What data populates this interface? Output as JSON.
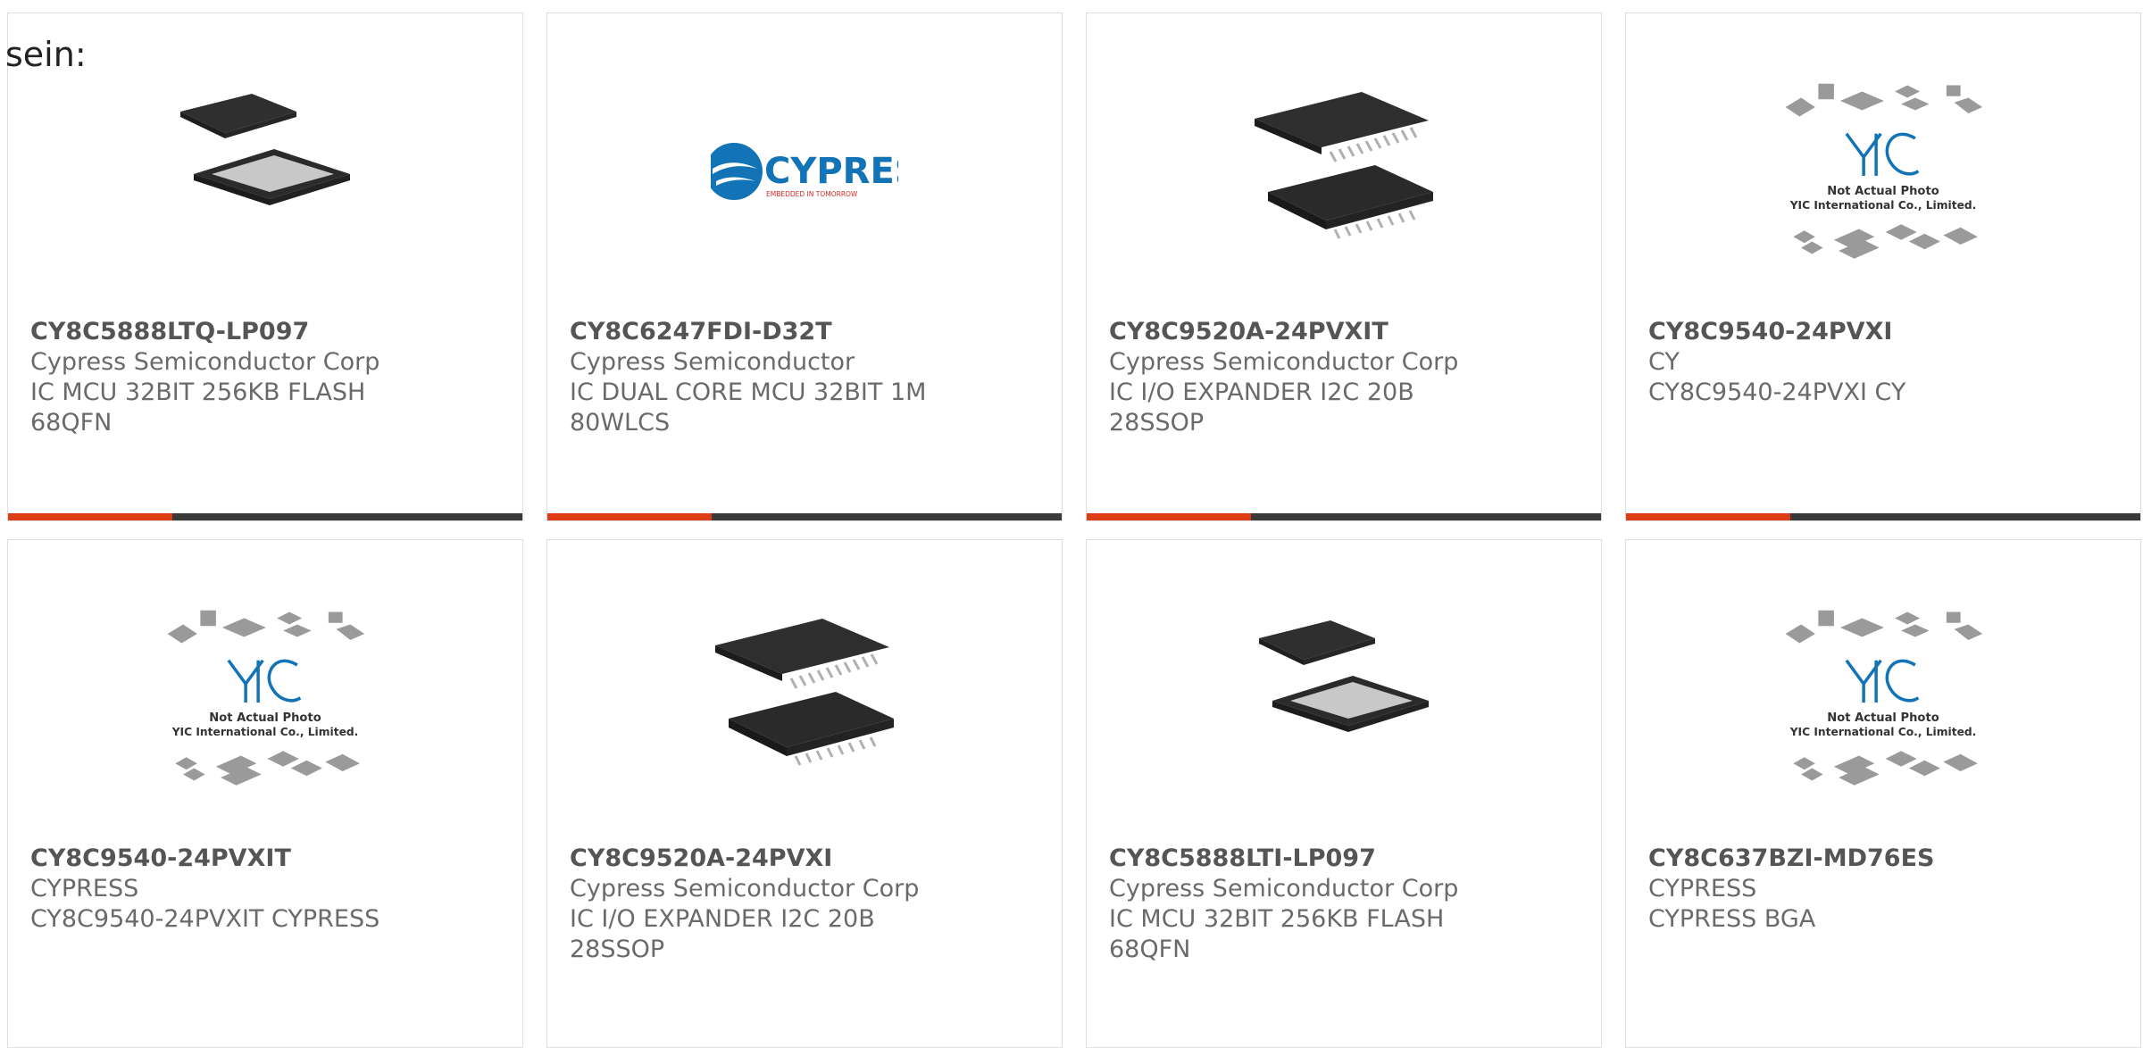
{
  "page": {
    "label": "sein:"
  },
  "products": [
    {
      "part_number": "CY8C5888LTQ-LP097",
      "manufacturer": "Cypress Semiconductor Corp",
      "description": "IC MCU 32BIT 256KB FLASH\n68QFN",
      "image": "qfn-chip-image",
      "progress": 0.32
    },
    {
      "part_number": "CY8C6247FDI-D32T",
      "manufacturer": "Cypress Semiconductor",
      "description": "IC DUAL CORE MCU 32BIT 1M\n80WLCS",
      "image": "cypress-logo-image",
      "logo_text": "CYPRESS",
      "logo_tagline": "EMBEDDED IN TOMORROW",
      "progress": 0.32
    },
    {
      "part_number": "CY8C9520A-24PVXIT",
      "manufacturer": "Cypress Semiconductor Corp",
      "description": "IC I/O EXPANDER I2C 20B\n28SSOP",
      "image": "ssop-chip-image",
      "progress": 0.32
    },
    {
      "part_number": "CY8C9540-24PVXI",
      "manufacturer": "CY",
      "description": "CY8C9540-24PVXI CY",
      "image": "yic-placeholder-image",
      "placeholder_line1": "Not Actual Photo",
      "placeholder_line2": "YIC International Co., Limited.",
      "progress": 0.32
    },
    {
      "part_number": "CY8C9540-24PVXIT",
      "manufacturer": "CYPRESS",
      "description": "CY8C9540-24PVXIT CYPRESS",
      "image": "yic-placeholder-image",
      "placeholder_line1": "Not Actual Photo",
      "placeholder_line2": "YIC International Co., Limited."
    },
    {
      "part_number": "CY8C9520A-24PVXI",
      "manufacturer": "Cypress Semiconductor Corp",
      "description": "IC I/O EXPANDER I2C 20B\n28SSOP",
      "image": "ssop-chip-image"
    },
    {
      "part_number": "CY8C5888LTI-LP097",
      "manufacturer": "Cypress Semiconductor Corp",
      "description": "IC MCU 32BIT 256KB FLASH\n68QFN",
      "image": "qfn-chip-image"
    },
    {
      "part_number": "CY8C637BZI-MD76ES",
      "manufacturer": "CYPRESS",
      "description": "CYPRESS BGA",
      "image": "yic-placeholder-image",
      "placeholder_line1": "Not Actual Photo",
      "placeholder_line2": "YIC International Co., Limited."
    }
  ],
  "colors": {
    "accent": "#dc3b13",
    "track": "#3a3a3a",
    "card_border": "#dddddd",
    "cypress_blue": "#1273b7",
    "cypress_red": "#d62b2a"
  }
}
